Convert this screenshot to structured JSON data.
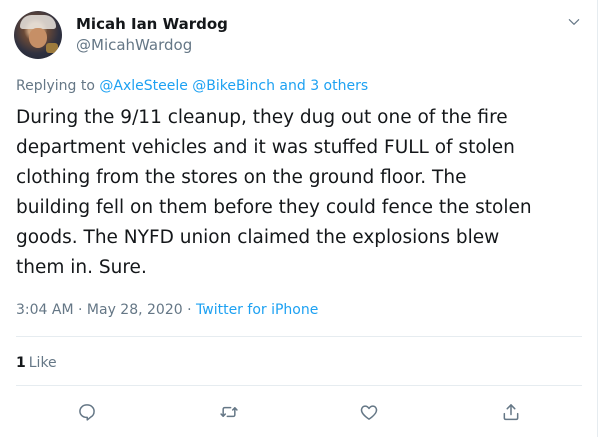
{
  "author": {
    "display_name": "Micah Ian Wardog",
    "handle": "@MicahWardog",
    "avatar_icon": "user-avatar"
  },
  "reply": {
    "prefix": "Replying to ",
    "mentions": "@AxleSteele @BikeBinch and 3 others"
  },
  "tweet": {
    "text": "During the 9/11 cleanup, they dug out one of the fire\ndepartment vehicles and it was stuffed FULL of stolen\nclothing from the stores on the ground floor. The\nbuilding fell on them before they could fence the stolen\ngoods. The NYFD union claimed the explosions blew\nthem in. Sure."
  },
  "meta": {
    "time": "3:04 AM",
    "separator1": " · ",
    "date": "May 28, 2020",
    "separator2": " · ",
    "source": "Twitter for iPhone"
  },
  "stats": {
    "likes_count": "1",
    "likes_label": "Like"
  },
  "actions": {
    "reply_icon": "reply-icon",
    "retweet_icon": "retweet-icon",
    "like_icon": "heart-icon",
    "share_icon": "share-icon"
  },
  "colors": {
    "text_primary": "#14171a",
    "text_secondary": "#657786",
    "link": "#1da1f2",
    "divider": "#e6ecf0"
  }
}
